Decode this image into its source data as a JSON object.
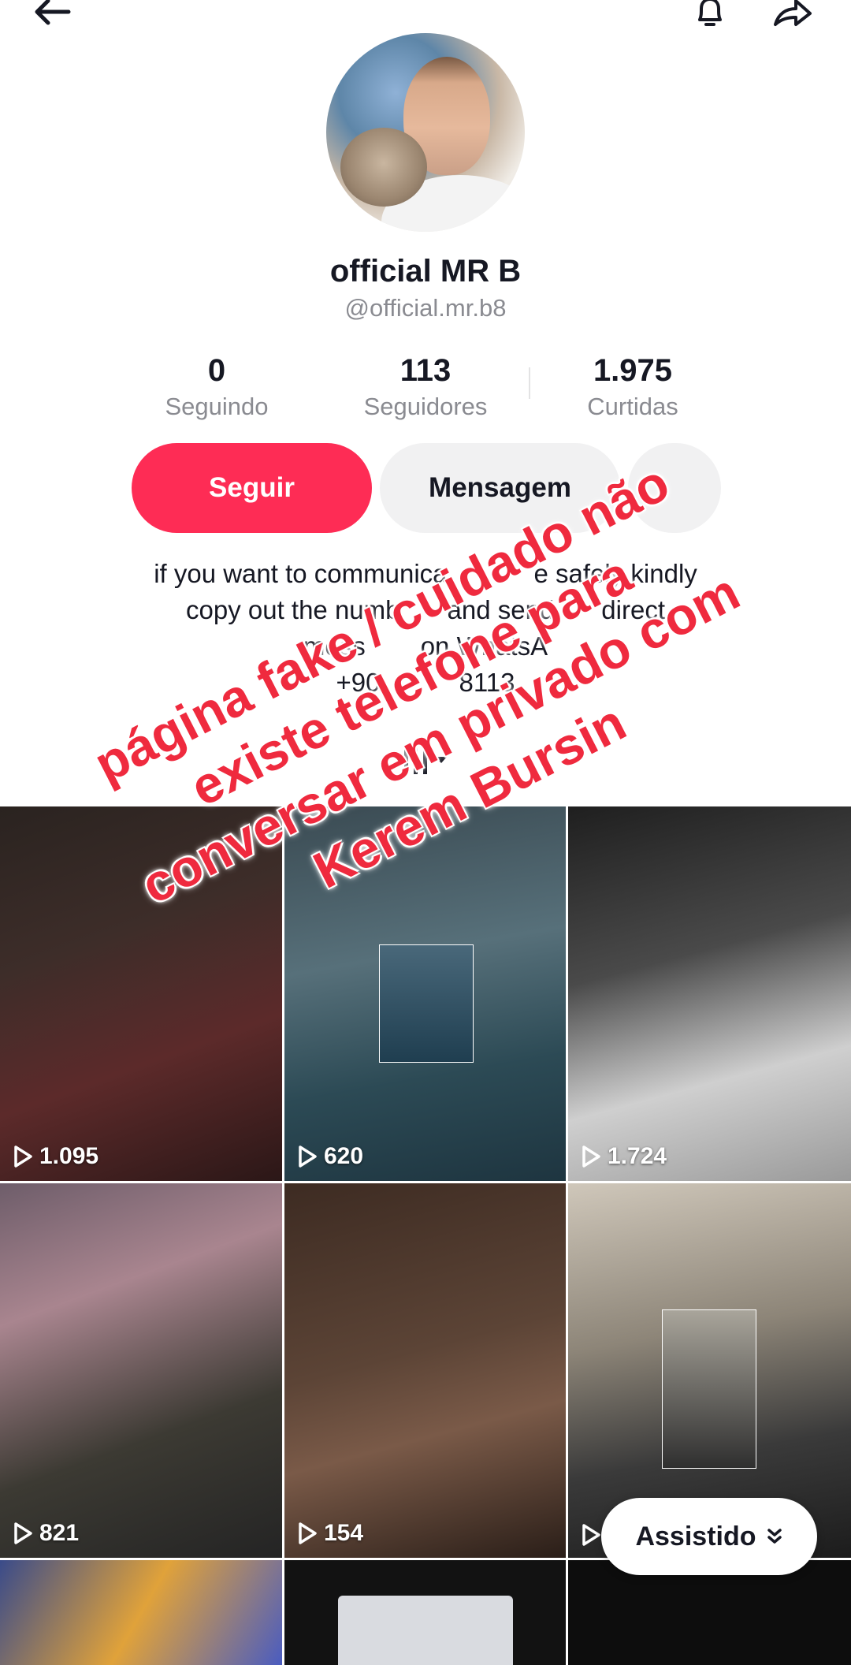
{
  "profile": {
    "name": "official MR B",
    "handle": "@official.mr.b8"
  },
  "stats": [
    {
      "value": "0",
      "label": "Seguindo"
    },
    {
      "value": "113",
      "label": "Seguidores"
    },
    {
      "value": "1.975",
      "label": "Curtidas"
    }
  ],
  "actions": {
    "follow_label": "Seguir",
    "message_label": "Mensagem"
  },
  "bio": {
    "lines": [
      "if you want to communica",
      "copy out the numb",
      "mess",
      "+90"
    ],
    "fragments": [
      "e safely kindly",
      "and send",
      "direct",
      "on WhatsA",
      "8113"
    ]
  },
  "videos": [
    {
      "views": "1.095"
    },
    {
      "views": "620"
    },
    {
      "views": "1.724"
    },
    {
      "views": "821"
    },
    {
      "views": "154"
    },
    {
      "views": ""
    }
  ],
  "watched_button": {
    "label": "Assistido"
  },
  "overlay_caption": {
    "lines": [
      "página fake / cuidado não",
      "existe telefone para",
      "conversar em privado com",
      "Kerem Bursin"
    ]
  },
  "colors": {
    "accent": "#fe2c55",
    "caption": "#ef2a3e",
    "muted_text": "#8a8b91"
  },
  "icons": [
    "back-arrow-icon",
    "bell-icon",
    "share-icon",
    "grid-sort-icon",
    "play-icon",
    "double-chevron-down-icon"
  ]
}
